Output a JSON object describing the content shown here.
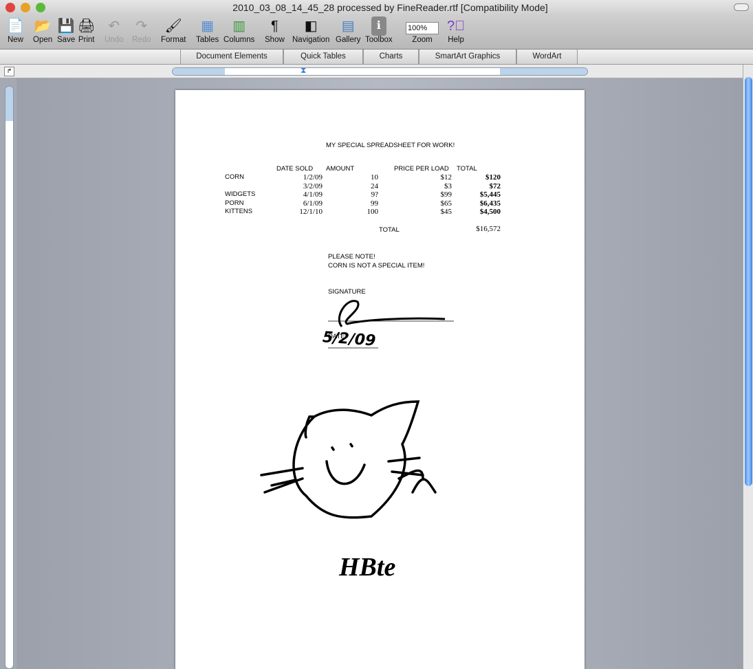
{
  "window": {
    "title": "2010_03_08_14_45_28 processed by FineReader.rtf [Compatibility Mode]"
  },
  "toolbar": {
    "new": "New",
    "open": "Open",
    "save": "Save",
    "print": "Print",
    "undo": "Undo",
    "redo": "Redo",
    "format": "Format",
    "tables": "Tables",
    "columns": "Columns",
    "show": "Show",
    "navigation": "Navigation",
    "gallery": "Gallery",
    "toolbox": "Toolbox",
    "zoom_value": "100%",
    "zoom": "Zoom",
    "help": "Help"
  },
  "ribbon": {
    "tabs": [
      "Document Elements",
      "Quick Tables",
      "Charts",
      "SmartArt Graphics",
      "WordArt"
    ]
  },
  "document": {
    "title": "MY SPECIAL SPREADSHEET FOR WORK!",
    "headers": [
      "DATE SOLD",
      "AMOUNT",
      "PRICE PER LOAD",
      "TOTAL"
    ],
    "rows": [
      {
        "item": "CORN",
        "date": "1/2/09",
        "amount": "10",
        "price": "$12",
        "total": "$120"
      },
      {
        "item": "",
        "date": "3/2/09",
        "amount": "24",
        "price": "$3",
        "total": "$72"
      },
      {
        "item": "WIDGETS",
        "date": "4/1/09",
        "amount": "9?",
        "price": "$99",
        "total": "$5,445"
      },
      {
        "item": "PORN",
        "date": "6/1/09",
        "amount": "99",
        "price": "$65",
        "total": "$6,435"
      },
      {
        "item": "KITTENS",
        "date": "12/1/10",
        "amount": "100",
        "price": "$45",
        "total": "$4,500"
      }
    ],
    "total_label": "TOTAL",
    "total_value": "$16,572",
    "note1": "PLEASE NOTE!",
    "note2": "CORN IS NOT A SPECIAL ITEM!",
    "signature_label": "SIGNATURE",
    "date_label": "DATE:",
    "handwritten_date": "5/2/09",
    "footer_text": "HBte"
  }
}
